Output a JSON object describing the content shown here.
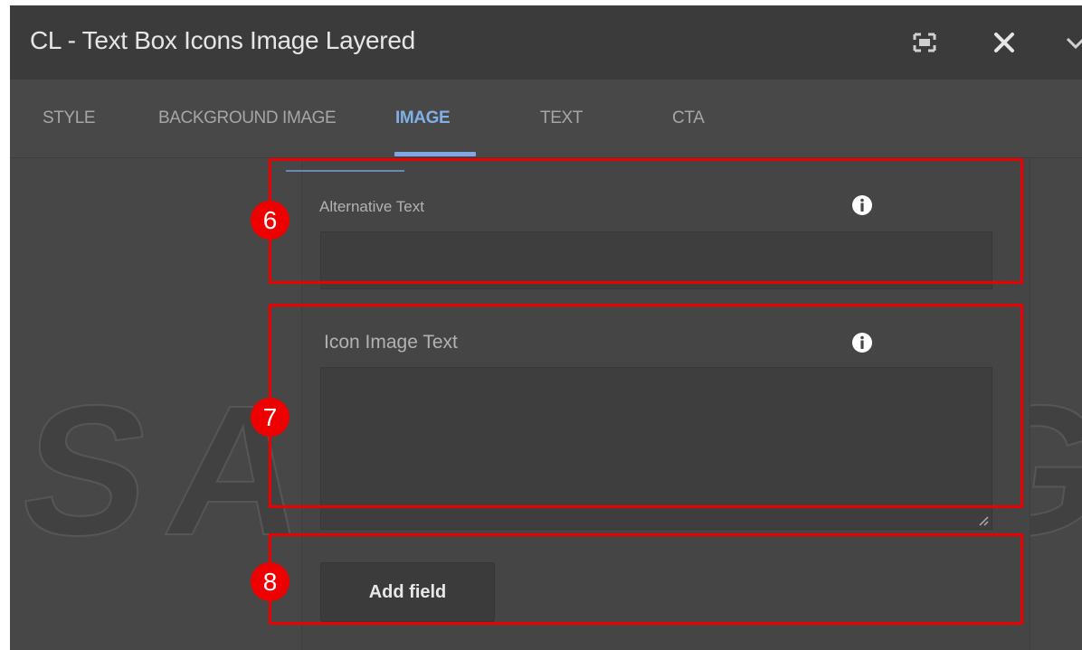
{
  "dialog": {
    "title": "CL - Text Box Icons Image Layered",
    "icons": [
      "fullscreen-icon",
      "close-icon",
      "chevron-down-icon"
    ]
  },
  "tabs": [
    {
      "label": "STYLE",
      "active": false
    },
    {
      "label": "BACKGROUND IMAGE",
      "active": false
    },
    {
      "label": "IMAGE",
      "active": true
    },
    {
      "label": "TEXT",
      "active": false
    },
    {
      "label": "CTA",
      "active": false
    }
  ],
  "watermark": "SAMSUNG",
  "form": {
    "alt_text_label": "Alternative Text",
    "alt_text_value": "",
    "icon_image_text_label": "Icon Image Text",
    "icon_image_text_value": "",
    "add_field_label": "Add field",
    "info_icon": "info-icon"
  },
  "annotations": [
    "6",
    "7",
    "8"
  ],
  "colors": {
    "accent_tab": "#7fb1e8",
    "annotation_red": "#ee0000",
    "dialog_bg": "#474747",
    "titlebar_bg": "#3b3b3b"
  }
}
